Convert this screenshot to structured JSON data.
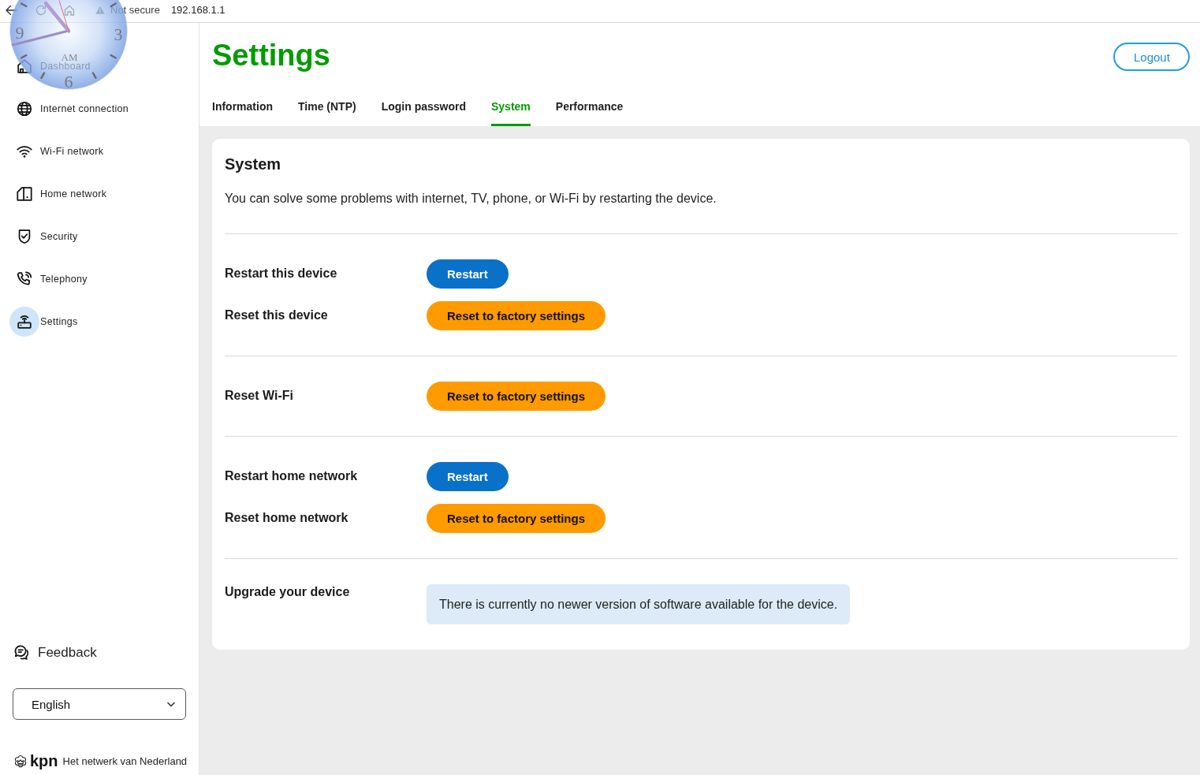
{
  "browser_bar": {
    "security_label": "Not secure",
    "address": "192.168.1.1"
  },
  "clock_widget": {
    "numerals": [
      "9",
      "3",
      "6"
    ],
    "period": "AM"
  },
  "sidebar": {
    "items": [
      {
        "label": "Dashboard",
        "selected": false
      },
      {
        "label": "Internet connection",
        "selected": false
      },
      {
        "label": "Wi-Fi network",
        "selected": false
      },
      {
        "label": "Home network",
        "selected": false
      },
      {
        "label": "Security",
        "selected": false
      },
      {
        "label": "Telephony",
        "selected": false
      },
      {
        "label": "Settings",
        "selected": true
      }
    ],
    "feedback": "Feedback",
    "language": {
      "value": "English"
    },
    "brand": {
      "logo": "kpn",
      "tagline": "Het netwerk van Nederland"
    }
  },
  "header": {
    "title": "Settings",
    "logout": "Logout"
  },
  "tabs": [
    {
      "label": "Information",
      "selected": false
    },
    {
      "label": "Time (NTP)",
      "selected": false
    },
    {
      "label": "Login password",
      "selected": false
    },
    {
      "label": "System",
      "selected": true
    },
    {
      "label": "Performance",
      "selected": false
    }
  ],
  "card": {
    "title": "System",
    "description": "You can solve some problems with internet, TV, phone, or Wi-Fi by restarting the device.",
    "sections": [
      {
        "rows": [
          {
            "label": "Restart this device",
            "kind": "primary",
            "text": "Restart"
          },
          {
            "label": "Reset this device",
            "kind": "warning",
            "text": "Reset to factory settings"
          }
        ]
      },
      {
        "rows": [
          {
            "label": "Reset Wi-Fi",
            "kind": "warning",
            "text": "Reset to factory settings"
          }
        ]
      },
      {
        "rows": [
          {
            "label": "Restart home network",
            "kind": "primary",
            "text": "Restart"
          },
          {
            "label": "Reset home network",
            "kind": "warning",
            "text": "Reset to factory settings"
          }
        ]
      },
      {
        "rows": [
          {
            "label": "Upgrade your device",
            "kind": "notice",
            "text": "There is currently no newer version of software available for the device."
          }
        ]
      }
    ]
  }
}
